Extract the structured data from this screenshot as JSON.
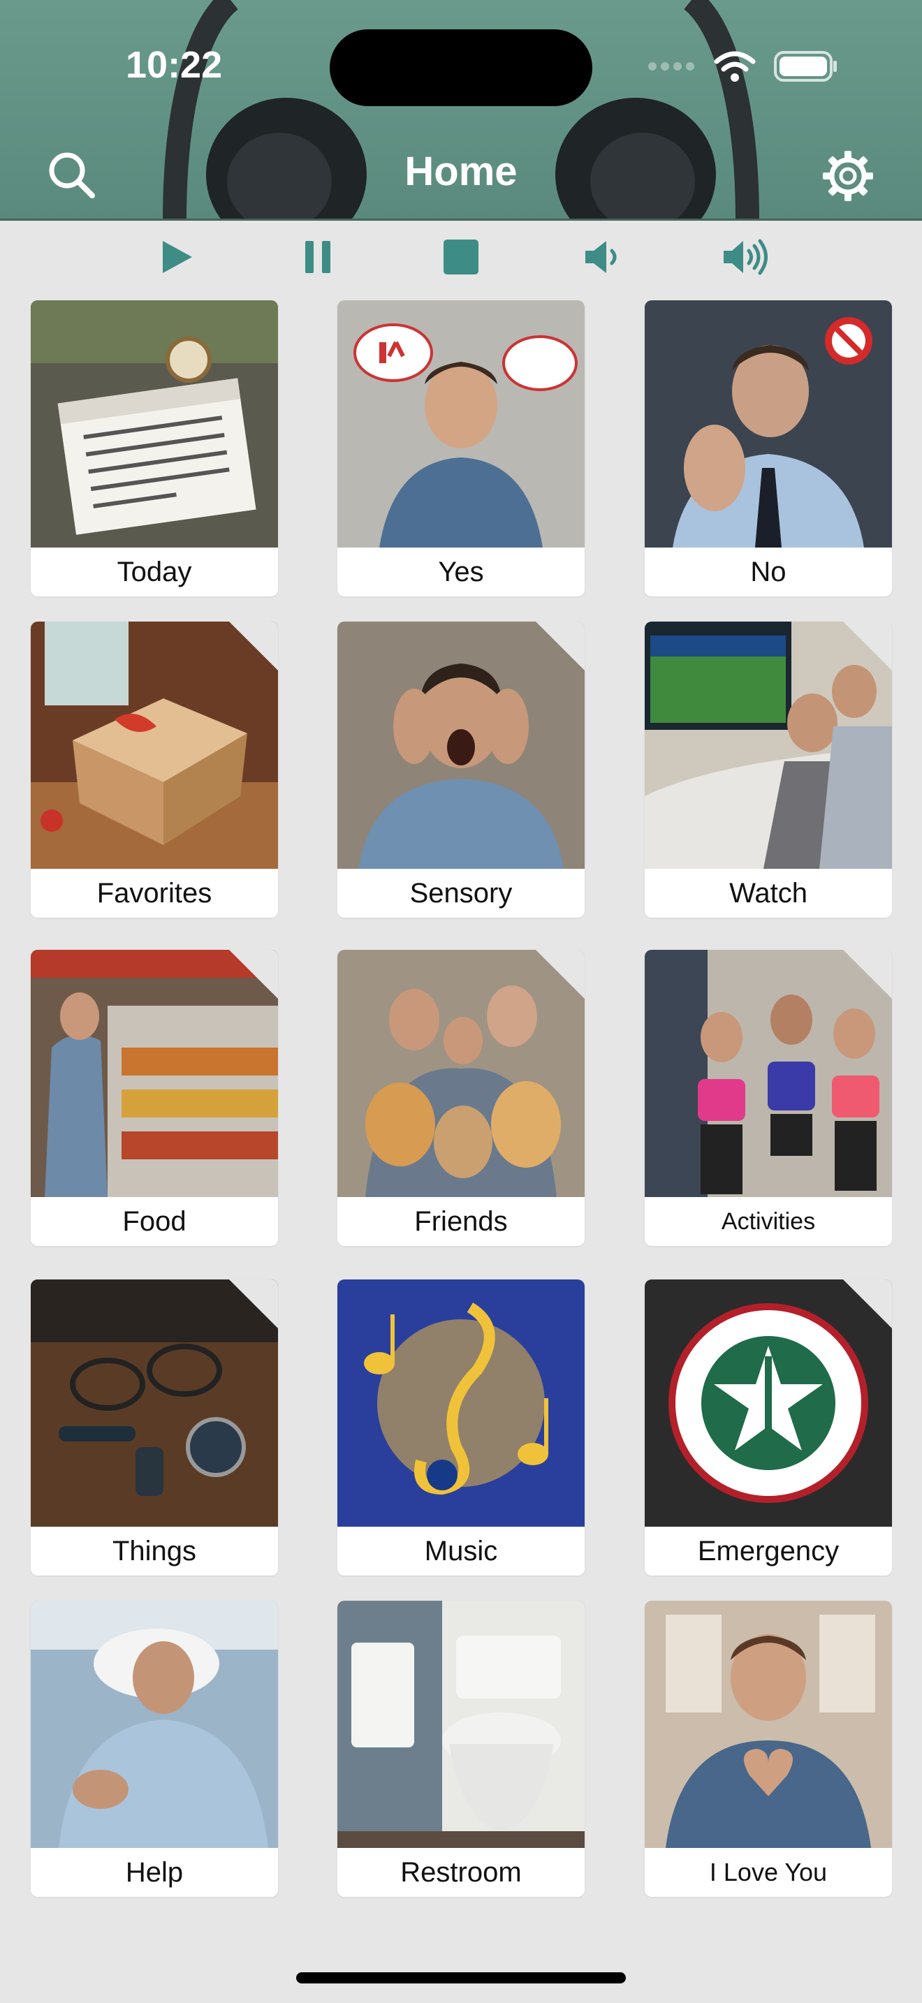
{
  "status_bar": {
    "time": "10:22"
  },
  "header": {
    "title": "Home",
    "accent": "#5f8f82"
  },
  "controls": [
    {
      "name": "play-button",
      "icon": "play-icon"
    },
    {
      "name": "pause-button",
      "icon": "pause-icon"
    },
    {
      "name": "stop-button",
      "icon": "stop-icon"
    },
    {
      "name": "volume-low-button",
      "icon": "volume-low-icon"
    },
    {
      "name": "volume-high-button",
      "icon": "volume-high-icon"
    }
  ],
  "tiles": [
    {
      "label": "Today",
      "folder": false
    },
    {
      "label": "Yes",
      "folder": false
    },
    {
      "label": "No",
      "folder": false
    },
    {
      "label": "Favorites",
      "folder": true
    },
    {
      "label": "Sensory",
      "folder": true
    },
    {
      "label": "Watch",
      "folder": true
    },
    {
      "label": "Food",
      "folder": true
    },
    {
      "label": "Friends",
      "folder": true
    },
    {
      "label": "Activities",
      "folder": true
    },
    {
      "label": "Things",
      "folder": true
    },
    {
      "label": "Music",
      "folder": false
    },
    {
      "label": "Emergency",
      "folder": true
    },
    {
      "label": "Help",
      "folder": false
    },
    {
      "label": "Restroom",
      "folder": false
    },
    {
      "label": "I Love You",
      "folder": false
    }
  ]
}
